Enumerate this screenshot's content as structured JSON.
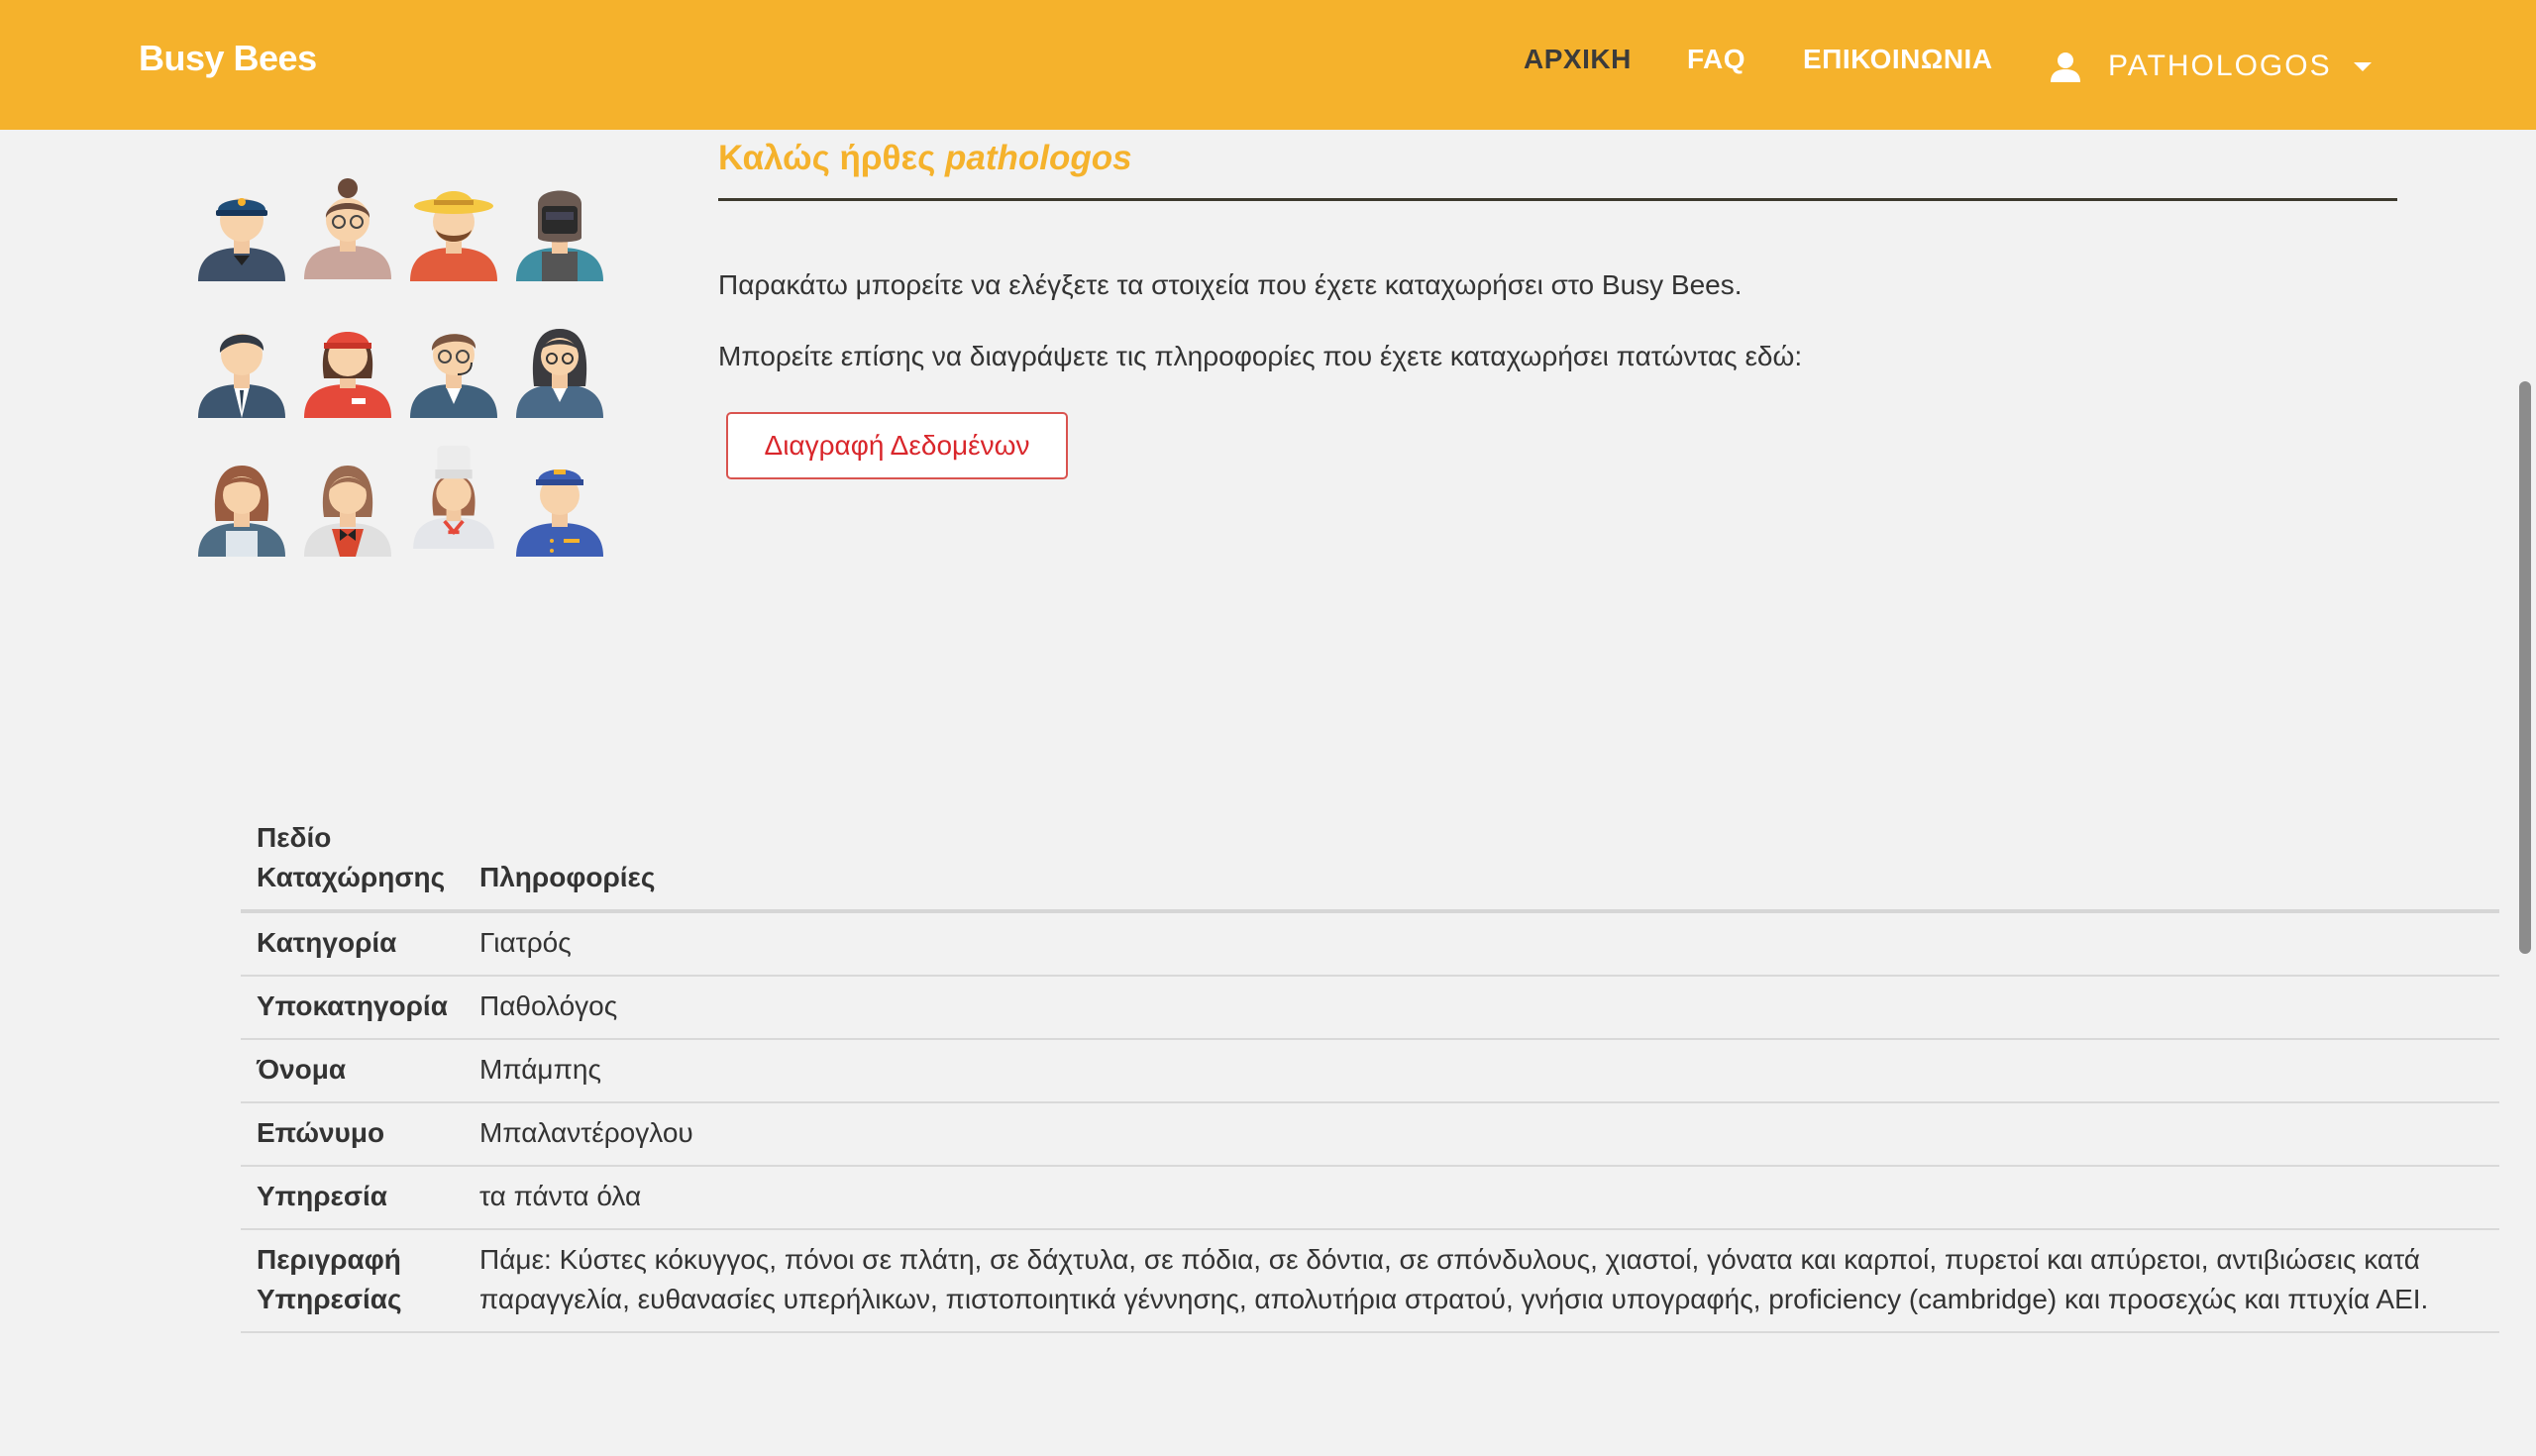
{
  "navbar": {
    "brand": "Busy Bees",
    "links": [
      "ΑΡΧΙΚΗ",
      "FAQ",
      "ΕΠΙΚΟΙΝΩΝΙΑ"
    ],
    "user": "PATHOLOGOS",
    "bg_color": "#f5b22c"
  },
  "welcome": {
    "prefix": "Καλώς ήρθες ",
    "username": "pathologos",
    "line1": "Παρακάτω μπορείτε να ελέγξετε τα στοιχεία που έχετε καταχωρήσει στο Busy Bees.",
    "line2": "Μπορείτε επίσης να διαγράψετε τις πληροφορίες που έχετε καταχωρήσει πατώντας εδώ:",
    "delete_button": "Διαγραφή Δεδομένων"
  },
  "table": {
    "headers": [
      "Πεδίο Καταχώρησης",
      "Πληροφορίες"
    ],
    "rows": [
      {
        "field": "Κατηγορία",
        "value": "Γιατρός"
      },
      {
        "field": "Υποκατηγορία",
        "value": "Παθολόγος"
      },
      {
        "field": "Όνομα",
        "value": "Μπάμπης"
      },
      {
        "field": "Επώνυμο",
        "value": "Μπαλαντέρογλου"
      },
      {
        "field": "Υπηρεσία",
        "value": "τα πάντα όλα"
      },
      {
        "field": "Περιγραφή Υπηρεσίας",
        "value": "Πάμε: Κύστες κόκυγγος, πόνοι σε πλάτη, σε δάχτυλα, σε πόδια, σε δόντια, σε σπόνδυλους, χιαστοί, γόνατα και καρποί, πυρετοί και απύρετοι, αντιβιώσεις κατά παραγγελία, ευθανασίες υπερήλικων, πιστοποιητικά γέννησης, απολυτήρια στρατού, γνήσια υπογραφής, proficiency (cambridge) και προσεχώς και πτυχία ΑΕΙ."
      }
    ]
  },
  "avatars": [
    "worker-police-icon",
    "woman-glasses-icon",
    "farmer-hat-icon",
    "welder-mask-icon",
    "man-suit-icon",
    "woman-cap-red-icon",
    "man-headset-icon",
    "woman-dark-hair-icon",
    "woman-apron-icon",
    "waitress-bowtie-icon",
    "chef-woman-icon",
    "porter-blue-icon"
  ]
}
